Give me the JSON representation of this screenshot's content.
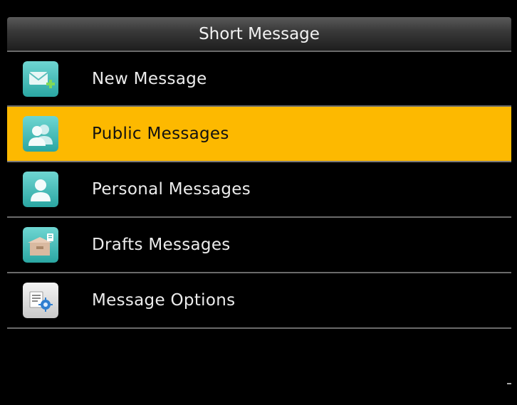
{
  "header": {
    "title": "Short Message"
  },
  "menu": {
    "items": [
      {
        "label": "New Message",
        "icon": "new-message-icon",
        "selected": false
      },
      {
        "label": "Public Messages",
        "icon": "public-messages-icon",
        "selected": true
      },
      {
        "label": "Personal Messages",
        "icon": "personal-messages-icon",
        "selected": false
      },
      {
        "label": "Drafts Messages",
        "icon": "drafts-messages-icon",
        "selected": false
      },
      {
        "label": "Message Options",
        "icon": "message-options-icon",
        "selected": false
      }
    ]
  },
  "colors": {
    "selected_background": "#fdb900",
    "background": "#000000",
    "text": "#ececec",
    "icon_teal": "#3dbdb8"
  }
}
